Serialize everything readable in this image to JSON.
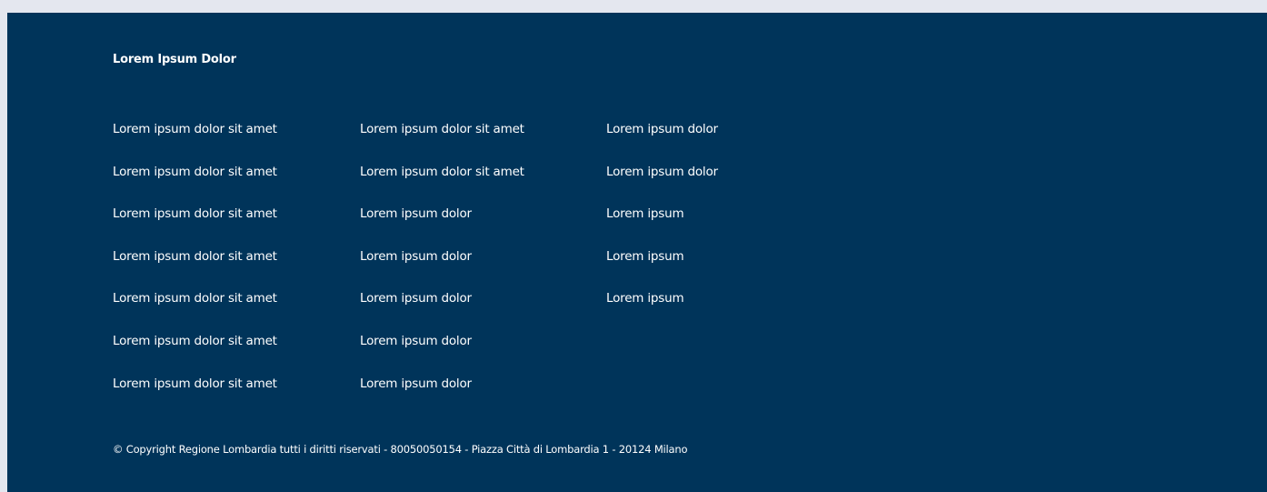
{
  "footer": {
    "title": "Lorem Ipsum Dolor",
    "columns": [
      [
        "Lorem ipsum dolor sit amet",
        "Lorem ipsum dolor sit amet",
        "Lorem ipsum dolor sit amet",
        "Lorem ipsum dolor sit amet",
        "Lorem ipsum dolor sit amet",
        "Lorem ipsum dolor sit amet",
        "Lorem ipsum dolor sit amet"
      ],
      [
        "Lorem ipsum dolor sit amet",
        "Lorem ipsum dolor sit amet",
        "Lorem ipsum dolor",
        "Lorem ipsum dolor",
        "Lorem ipsum dolor",
        "Lorem ipsum dolor",
        "Lorem ipsum dolor"
      ],
      [
        "Lorem ipsum dolor",
        "Lorem ipsum dolor",
        "Lorem ipsum",
        "Lorem ipsum",
        "Lorem ipsum"
      ]
    ],
    "copyright": "© Copyright Regione Lombardia tutti i diritti riservati - 80050050154 - Piazza Città di Lombardia 1 - 20124 Milano"
  },
  "colors": {
    "page_background": "#e4e7ef",
    "footer_background": "#00345a",
    "text": "#ffffff"
  }
}
